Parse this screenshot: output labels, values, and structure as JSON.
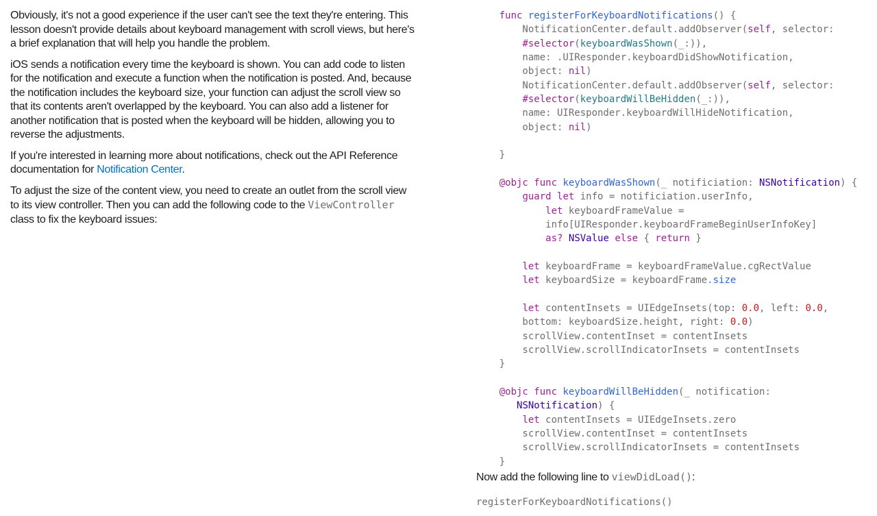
{
  "prose": {
    "p1": "Obviously, it's not a good experience if the user can't see the text they're entering. This lesson doesn't provide details about keyboard management with scroll views, but here's a brief explanation that will help you handle the problem.",
    "p2": "iOS sends a notification every time the keyboard is shown. You can add code to listen for the notification and execute a function when the notification is posted. And, because the notification includes the keyboard size, your function can adjust the scroll view so that its contents aren't overlapped by the keyboard. You can also add a listener for another notification that is posted when the keyboard will be hidden, allowing you to reverse the adjustments.",
    "p3_before": "If you're interested in learning more about notifications, check out the API Reference documentation for ",
    "p3_link": "Notification Center",
    "p3_after": ".",
    "p4_before": "To adjust the size of the content view, you need to create an outlet from the scroll view to its view controller. Then you can add the following code to the ",
    "p4_code": "ViewController",
    "p4_after": " class to fix the keyboard issues:"
  },
  "code_lines": [
    "    func registerForKeyboardNotifications() {",
    "        NotificationCenter.default.addObserver(self, selector:",
    "        #selector(keyboardWasShown(_:)),",
    "        name: .UIResponder.keyboardDidShowNotification,",
    "        object: nil)",
    "        NotificationCenter.default.addObserver(self, selector:",
    "        #selector(keyboardWillBeHidden(_:)),",
    "        name: UIResponder.keyboardWillHideNotification,",
    "        object: nil)",
    "",
    "    }",
    "",
    "    @objc func keyboardWasShown(_ notificiation: NSNotification) {",
    "        guard let info = notificiation.userInfo,",
    "            let keyboardFrameValue =",
    "            info[UIResponder.keyboardFrameBeginUserInfoKey]",
    "            as? NSValue else { return }",
    "",
    "        let keyboardFrame = keyboardFrameValue.cgRectValue",
    "        let keyboardSize = keyboardFrame.size",
    "",
    "        let contentInsets = UIEdgeInsets(top: 0.0, left: 0.0,",
    "        bottom: keyboardSize.height, right: 0.0)",
    "        scrollView.contentInset = contentInsets",
    "        scrollView.scrollIndicatorInsets = contentInsets",
    "    }",
    "",
    "    @objc func keyboardWillBeHidden(_ notification:",
    "       NSNotification) {",
    "        let contentInsets = UIEdgeInsets.zero",
    "        scrollView.contentInset = contentInsets",
    "        scrollView.scrollIndicatorInsets = contentInsets",
    "    }"
  ],
  "after": {
    "before": "Now add the following line to ",
    "code": "viewDidLoad()",
    "after": ":"
  },
  "after_code": "registerForKeyboardNotifications()"
}
